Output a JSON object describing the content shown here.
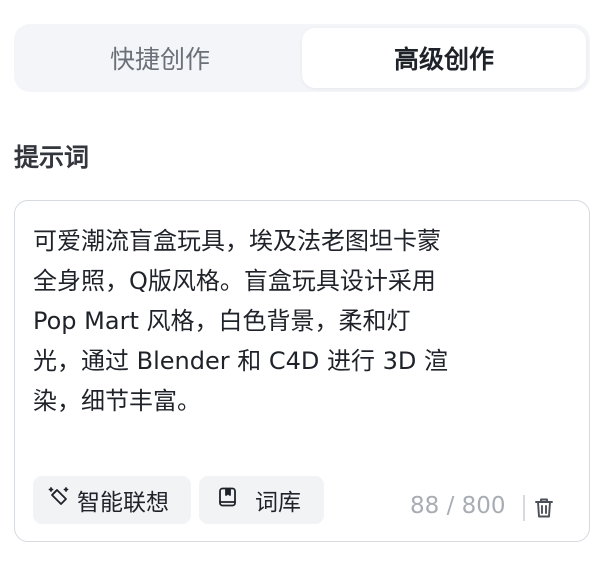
{
  "tabs": [
    {
      "label": "快捷创作",
      "active": false
    },
    {
      "label": "高级创作",
      "active": true
    }
  ],
  "prompt": {
    "title": "提示词",
    "text": "可爱潮流盲盒玩具，埃及法老图坦卡蒙\n全身照，Q版风格。盲盒玩具设计采用\nPop Mart 风格，白色背景，柔和灯\n光，通过 Blender 和 C4D 进行 3D 渲\n染，细节丰富。",
    "counter": "88 / 800",
    "actions": {
      "association": {
        "label": "智能联想",
        "icon": "magic-wand-icon"
      },
      "library": {
        "label": "词库",
        "icon": "book-icon"
      },
      "clear": {
        "icon": "trash-icon"
      }
    }
  },
  "colors": {
    "switch_bg": "#f3f5f8",
    "chip_bg": "#f2f3f5",
    "border": "#d6d9de",
    "muted_text": "#a8adb4"
  }
}
